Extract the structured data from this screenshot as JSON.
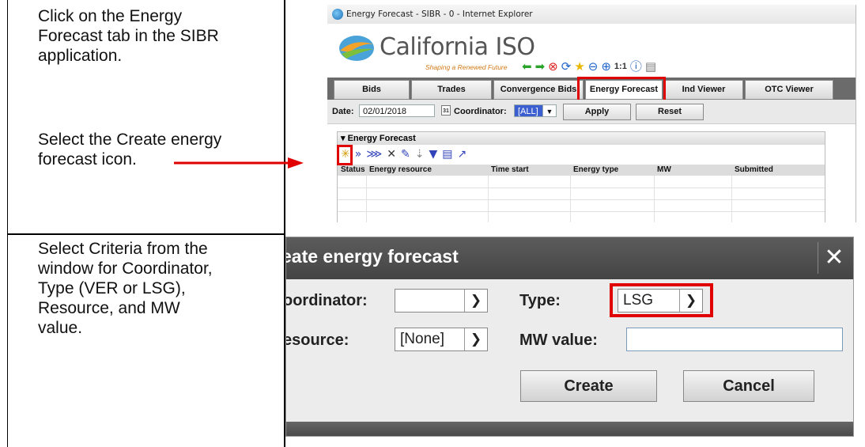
{
  "instructions": {
    "step1": "Click on the Energy\nForecast  tab in the SIBR\napplication.",
    "step2": "Select the Create energy\nforecast icon.",
    "step3": "Select Criteria from the\nwindow for Coordinator,\nType (VER or LSG),\nResource, and MW\nvalue."
  },
  "browser": {
    "window_title": "Energy Forecast - SIBR - 0 - Internet Explorer"
  },
  "brand": {
    "name": "California ISO",
    "tagline": "Shaping a Renewed Future",
    "zoom_label": "1:1"
  },
  "tabs": [
    {
      "label": "Bids"
    },
    {
      "label": "Trades"
    },
    {
      "label": "Convergence Bids"
    },
    {
      "label": "Energy Forecast"
    },
    {
      "label": "Ind Viewer"
    },
    {
      "label": "OTC Viewer"
    }
  ],
  "filters": {
    "date_label": "Date:",
    "date_value": "02/01/2018",
    "calendar_day": "31",
    "coordinator_label": "Coordinator:",
    "coordinator_value": "[ALL]",
    "apply_label": "Apply",
    "reset_label": "Reset"
  },
  "panel": {
    "title": "Energy Forecast",
    "columns": [
      "Status",
      "Energy resource",
      "Time start",
      "Energy type",
      "MW",
      "Submitted"
    ]
  },
  "dialog": {
    "title": "eate energy forecast",
    "coordinator_label": "oordinator:",
    "coordinator_value": "",
    "resource_label": "esource:",
    "resource_value": "[None]",
    "type_label": "Type:",
    "type_value": "LSG",
    "mw_label": "MW value:",
    "mw_value": "",
    "create_label": "Create",
    "cancel_label": "Cancel"
  },
  "colors": {
    "highlight": "#e00000",
    "tab_bar": "#6b6b6b",
    "dialog_title": "#4f4f4f"
  }
}
